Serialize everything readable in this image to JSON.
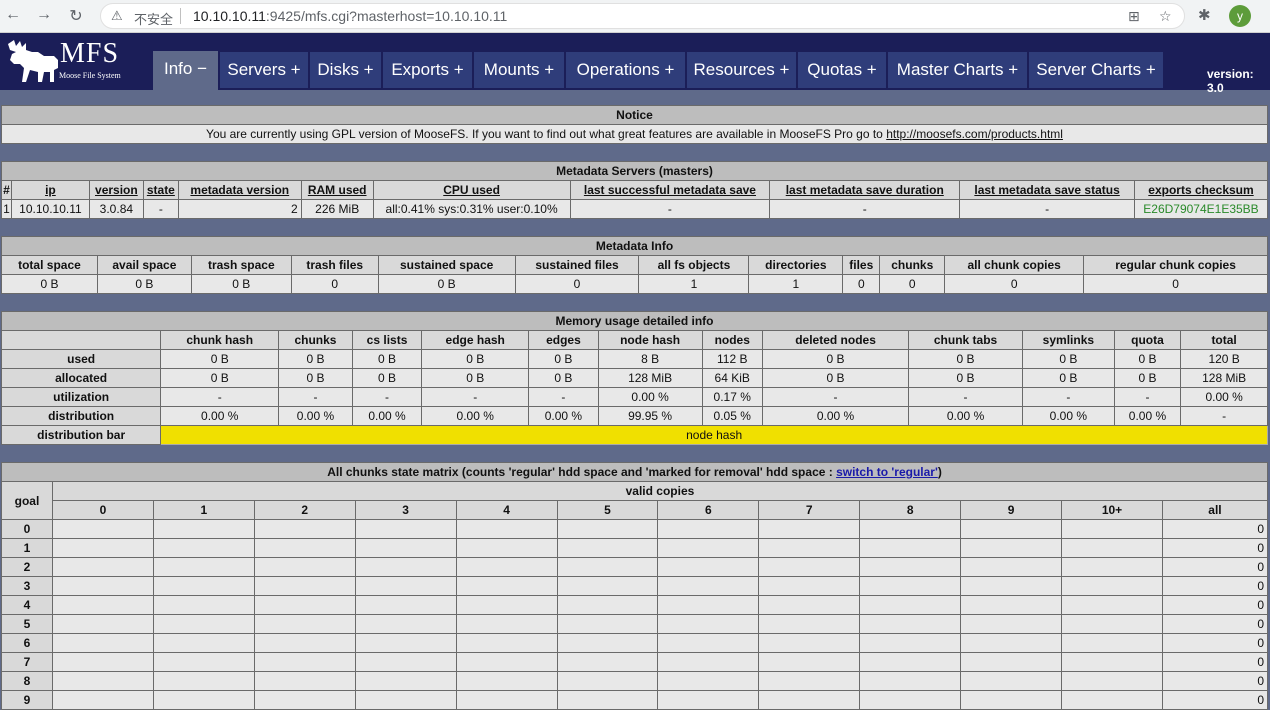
{
  "browser": {
    "insecure_label": "不安全",
    "url_host": "10.10.10.11",
    "url_rest": ":9425/mfs.cgi?masterhost=10.10.10.11",
    "profile_initial": "y"
  },
  "logo": {
    "title": "MFS",
    "subtitle": "Moose File System"
  },
  "tabs": [
    {
      "label": "Info −"
    },
    {
      "label": "Servers +"
    },
    {
      "label": "Disks +"
    },
    {
      "label": "Exports +"
    },
    {
      "label": "Mounts +"
    },
    {
      "label": "Operations +"
    },
    {
      "label": "Resources +"
    },
    {
      "label": "Quotas +"
    },
    {
      "label": "Master Charts +"
    },
    {
      "label": "Server Charts +"
    }
  ],
  "version_label": "version: 3.0",
  "notice": {
    "title": "Notice",
    "text": "You are currently using GPL version of MooseFS. If you want to find out what great features are available in MooseFS Pro go to ",
    "link": "http://moosefs.com/products.html"
  },
  "masters": {
    "title": "Metadata Servers (masters)",
    "headers": [
      "#",
      "ip",
      "version",
      "state",
      "metadata version",
      "RAM used",
      "CPU used",
      "last successful metadata save",
      "last metadata save duration",
      "last metadata save status",
      "exports checksum"
    ],
    "row": [
      "1",
      "10.10.10.11",
      "3.0.84",
      "-",
      "2",
      "226 MiB",
      "all:0.41% sys:0.31% user:0.10%",
      "-",
      "-",
      "-",
      "E26D79074E1E35BB"
    ]
  },
  "metainfo": {
    "title": "Metadata Info",
    "headers": [
      "total space",
      "avail space",
      "trash space",
      "trash files",
      "sustained space",
      "sustained files",
      "all fs objects",
      "directories",
      "files",
      "chunks",
      "all chunk copies",
      "regular chunk copies"
    ],
    "row": [
      "0 B",
      "0 B",
      "0 B",
      "0",
      "0 B",
      "0",
      "1",
      "1",
      "0",
      "0",
      "0",
      "0"
    ]
  },
  "memory": {
    "title": "Memory usage detailed info",
    "headers": [
      "chunk hash",
      "chunks",
      "cs lists",
      "edge hash",
      "edges",
      "node hash",
      "nodes",
      "deleted nodes",
      "chunk tabs",
      "symlinks",
      "quota",
      "total"
    ],
    "rows": [
      {
        "label": "used",
        "cells": [
          "0 B",
          "0 B",
          "0 B",
          "0 B",
          "0 B",
          "8 B",
          "112 B",
          "0 B",
          "0 B",
          "0 B",
          "0 B",
          "120 B"
        ]
      },
      {
        "label": "allocated",
        "cells": [
          "0 B",
          "0 B",
          "0 B",
          "0 B",
          "0 B",
          "128 MiB",
          "64 KiB",
          "0 B",
          "0 B",
          "0 B",
          "0 B",
          "128 MiB"
        ]
      },
      {
        "label": "utilization",
        "cells": [
          "-",
          "-",
          "-",
          "-",
          "-",
          "0.00 %",
          "0.17 %",
          "-",
          "-",
          "-",
          "-",
          "0.00 %"
        ]
      },
      {
        "label": "distribution",
        "cells": [
          "0.00 %",
          "0.00 %",
          "0.00 %",
          "0.00 %",
          "0.00 %",
          "99.95 %",
          "0.05 %",
          "0.00 %",
          "0.00 %",
          "0.00 %",
          "0.00 %",
          "-"
        ]
      }
    ],
    "bar_label": "distribution bar",
    "bar_text": "node hash",
    "bar_color": "#f0e000"
  },
  "matrix": {
    "title_prefix": "All chunks state matrix (counts 'regular' hdd space and 'marked for removal' hdd space : ",
    "title_link": "switch to 'regular'",
    "title_suffix": ")",
    "goal_label": "goal",
    "valid_label": "valid copies",
    "columns": [
      "0",
      "1",
      "2",
      "3",
      "4",
      "5",
      "6",
      "7",
      "8",
      "9",
      "10+",
      "all"
    ],
    "rows": [
      {
        "goal": "0",
        "all": "0"
      },
      {
        "goal": "1",
        "all": "0"
      },
      {
        "goal": "2",
        "all": "0"
      },
      {
        "goal": "3",
        "all": "0"
      },
      {
        "goal": "4",
        "all": "0"
      },
      {
        "goal": "5",
        "all": "0"
      },
      {
        "goal": "6",
        "all": "0"
      },
      {
        "goal": "7",
        "all": "0"
      },
      {
        "goal": "8",
        "all": "0"
      },
      {
        "goal": "9",
        "all": "0"
      }
    ]
  }
}
